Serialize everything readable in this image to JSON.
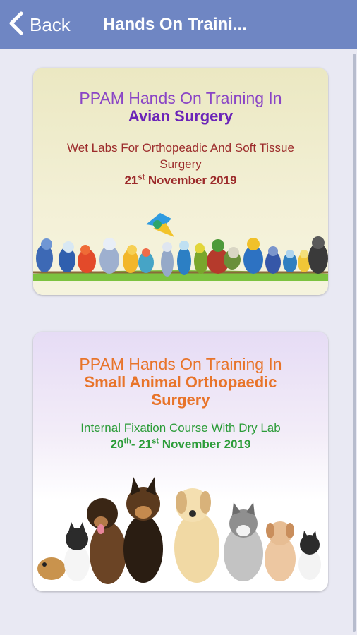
{
  "header": {
    "back_label": "Back",
    "title": "Hands On Traini..."
  },
  "colors": {
    "topbar": "#6f86c3",
    "card1_line1": "#8a45c6",
    "card1_line2": "#6b24b8",
    "card1_sub": "#9c2b2b",
    "card1_date": "#9c2b2b",
    "card2_title": "#e8742a",
    "card2_sub": "#2c9c39"
  },
  "cards": [
    {
      "line1": "PPAM Hands On Training In",
      "line2": "Avian Surgery",
      "subtitle_1": "Wet Labs For Orthopeadic And Soft Tissue",
      "subtitle_2": "Surgery",
      "date_day": "21",
      "date_day_sup": "st",
      "date_rest": " November 2019",
      "image": "birds-illustration"
    },
    {
      "line1": "PPAM Hands On Training In",
      "line2": "Small Animal Orthopaedic",
      "line3": "Surgery",
      "subtitle_1": "Internal Fixation Course With Dry Lab",
      "date_day1": "20",
      "date_day1_sup": "th",
      "date_sep": "- ",
      "date_day2": "21",
      "date_day2_sup": "st",
      "date_rest": " November 2019",
      "image": "pets-illustration"
    }
  ]
}
